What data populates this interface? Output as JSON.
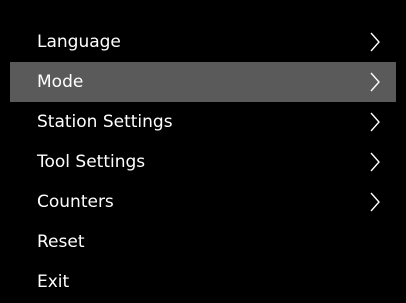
{
  "colors": {
    "background": "#000000",
    "selected_row": "#5a5a5a",
    "text": "#ffffff"
  },
  "menu": {
    "selected_index": 1,
    "items": [
      {
        "label": "Language",
        "icon": "chevron-right-icon",
        "submenu": true
      },
      {
        "label": "Mode",
        "icon": "chevron-right-icon",
        "submenu": true
      },
      {
        "label": "Station Settings",
        "icon": "chevron-right-icon",
        "submenu": true
      },
      {
        "label": "Tool Settings",
        "icon": "chevron-right-icon",
        "submenu": true
      },
      {
        "label": "Counters",
        "icon": "chevron-right-icon",
        "submenu": true
      },
      {
        "label": "Reset",
        "submenu": false
      },
      {
        "label": "Exit",
        "submenu": false
      }
    ]
  }
}
